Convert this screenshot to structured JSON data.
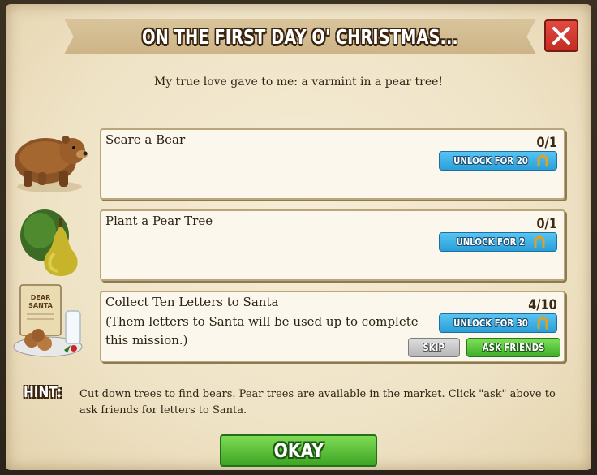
{
  "dialog": {
    "title": "ON THE FIRST DAY O' CHRISTMAS...",
    "subtitle": "My true love gave to me: a varmint in a pear tree!"
  },
  "tasks": [
    {
      "title": "Scare a Bear",
      "description": "",
      "count": "0/1",
      "unlock_label": "UNLOCK FOR 20",
      "icon": "bear-icon"
    },
    {
      "title": "Plant a Pear Tree",
      "description": "",
      "count": "0/1",
      "unlock_label": "UNLOCK FOR 2",
      "icon": "pear-tree-icon"
    },
    {
      "title": "Collect Ten Letters to Santa",
      "description": "(Them letters to Santa will be used up to complete this mission.)",
      "count": "4/10",
      "unlock_label": "UNLOCK FOR 30",
      "skip_label": "SKIP",
      "ask_label": "ASK FRIENDS",
      "icon": "santa-letter-cookies-icon",
      "icon_text": "DEAR SANTA"
    }
  ],
  "hint": {
    "label": "HINT:",
    "text": "Cut down trees to find bears. Pear trees are available in the market. Click \"ask\" above to ask friends for letters to Santa."
  },
  "okay_label": "OKAY",
  "colors": {
    "unlock_blue": "#2a9fd8",
    "ask_green": "#3fae2a",
    "close_red": "#c22d24",
    "horseshoe_gold": "#e0a21c"
  }
}
